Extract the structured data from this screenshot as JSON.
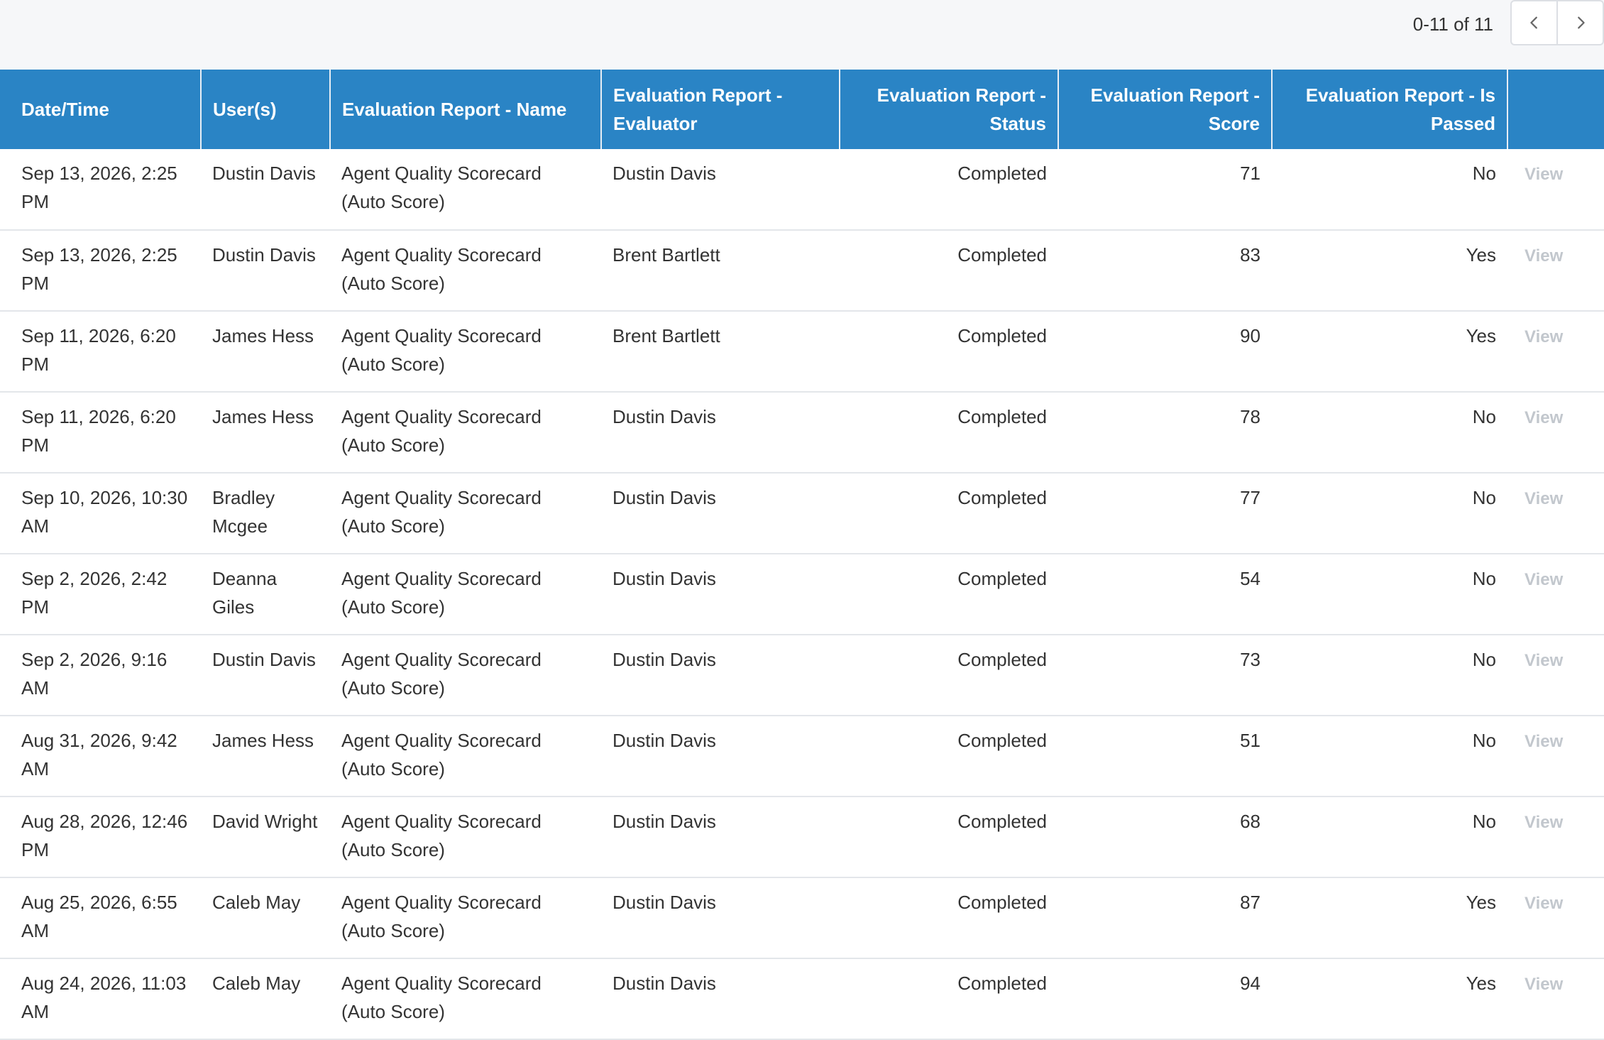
{
  "pagination": {
    "range_text": "0-11 of 11",
    "prev_icon": "chevron-left-icon",
    "next_icon": "chevron-right-icon"
  },
  "colors": {
    "header_bg": "#2a84c5",
    "top_bar_bg": "#f6f7f9",
    "view_link": "#c2c7cd"
  },
  "table": {
    "columns": [
      {
        "label": "Date/Time"
      },
      {
        "label": "User(s)"
      },
      {
        "label": "Evaluation Report - Name"
      },
      {
        "label": "Evaluation Report - Evaluator"
      },
      {
        "label": "Evaluation Report - Status"
      },
      {
        "label": "Evaluation Report - Score"
      },
      {
        "label": "Evaluation Report - Is Passed"
      },
      {
        "label": ""
      }
    ],
    "rows": [
      {
        "datetime": "Sep 13, 2026, 2:25 PM",
        "user": "Dustin Davis",
        "name": "Agent Quality Scorecard (Auto Score)",
        "evaluator": "Dustin Davis",
        "status": "Completed",
        "score": "71",
        "passed": "No",
        "action": "View"
      },
      {
        "datetime": "Sep 13, 2026, 2:25 PM",
        "user": "Dustin Davis",
        "name": "Agent Quality Scorecard (Auto Score)",
        "evaluator": "Brent Bartlett",
        "status": "Completed",
        "score": "83",
        "passed": "Yes",
        "action": "View"
      },
      {
        "datetime": "Sep 11, 2026, 6:20 PM",
        "user": "James Hess",
        "name": "Agent Quality Scorecard (Auto Score)",
        "evaluator": "Brent Bartlett",
        "status": "Completed",
        "score": "90",
        "passed": "Yes",
        "action": "View"
      },
      {
        "datetime": "Sep 11, 2026, 6:20 PM",
        "user": "James Hess",
        "name": "Agent Quality Scorecard (Auto Score)",
        "evaluator": "Dustin Davis",
        "status": "Completed",
        "score": "78",
        "passed": "No",
        "action": "View"
      },
      {
        "datetime": "Sep 10, 2026, 10:30 AM",
        "user": "Bradley Mcgee",
        "name": "Agent Quality Scorecard (Auto Score)",
        "evaluator": "Dustin Davis",
        "status": "Completed",
        "score": "77",
        "passed": "No",
        "action": "View"
      },
      {
        "datetime": "Sep 2, 2026, 2:42 PM",
        "user": "Deanna Giles",
        "name": "Agent Quality Scorecard (Auto Score)",
        "evaluator": "Dustin Davis",
        "status": "Completed",
        "score": "54",
        "passed": "No",
        "action": "View"
      },
      {
        "datetime": "Sep 2, 2026, 9:16 AM",
        "user": "Dustin Davis",
        "name": "Agent Quality Scorecard (Auto Score)",
        "evaluator": "Dustin Davis",
        "status": "Completed",
        "score": "73",
        "passed": "No",
        "action": "View"
      },
      {
        "datetime": "Aug 31, 2026, 9:42 AM",
        "user": "James Hess",
        "name": "Agent Quality Scorecard (Auto Score)",
        "evaluator": "Dustin Davis",
        "status": "Completed",
        "score": "51",
        "passed": "No",
        "action": "View"
      },
      {
        "datetime": "Aug 28, 2026, 12:46 PM",
        "user": "David Wright",
        "name": "Agent Quality Scorecard (Auto Score)",
        "evaluator": "Dustin Davis",
        "status": "Completed",
        "score": "68",
        "passed": "No",
        "action": "View"
      },
      {
        "datetime": "Aug 25, 2026, 6:55 AM",
        "user": "Caleb May",
        "name": "Agent Quality Scorecard (Auto Score)",
        "evaluator": "Dustin Davis",
        "status": "Completed",
        "score": "87",
        "passed": "Yes",
        "action": "View"
      },
      {
        "datetime": "Aug 24, 2026, 11:03 AM",
        "user": "Caleb May",
        "name": "Agent Quality Scorecard (Auto Score)",
        "evaluator": "Dustin Davis",
        "status": "Completed",
        "score": "94",
        "passed": "Yes",
        "action": "View"
      }
    ]
  }
}
